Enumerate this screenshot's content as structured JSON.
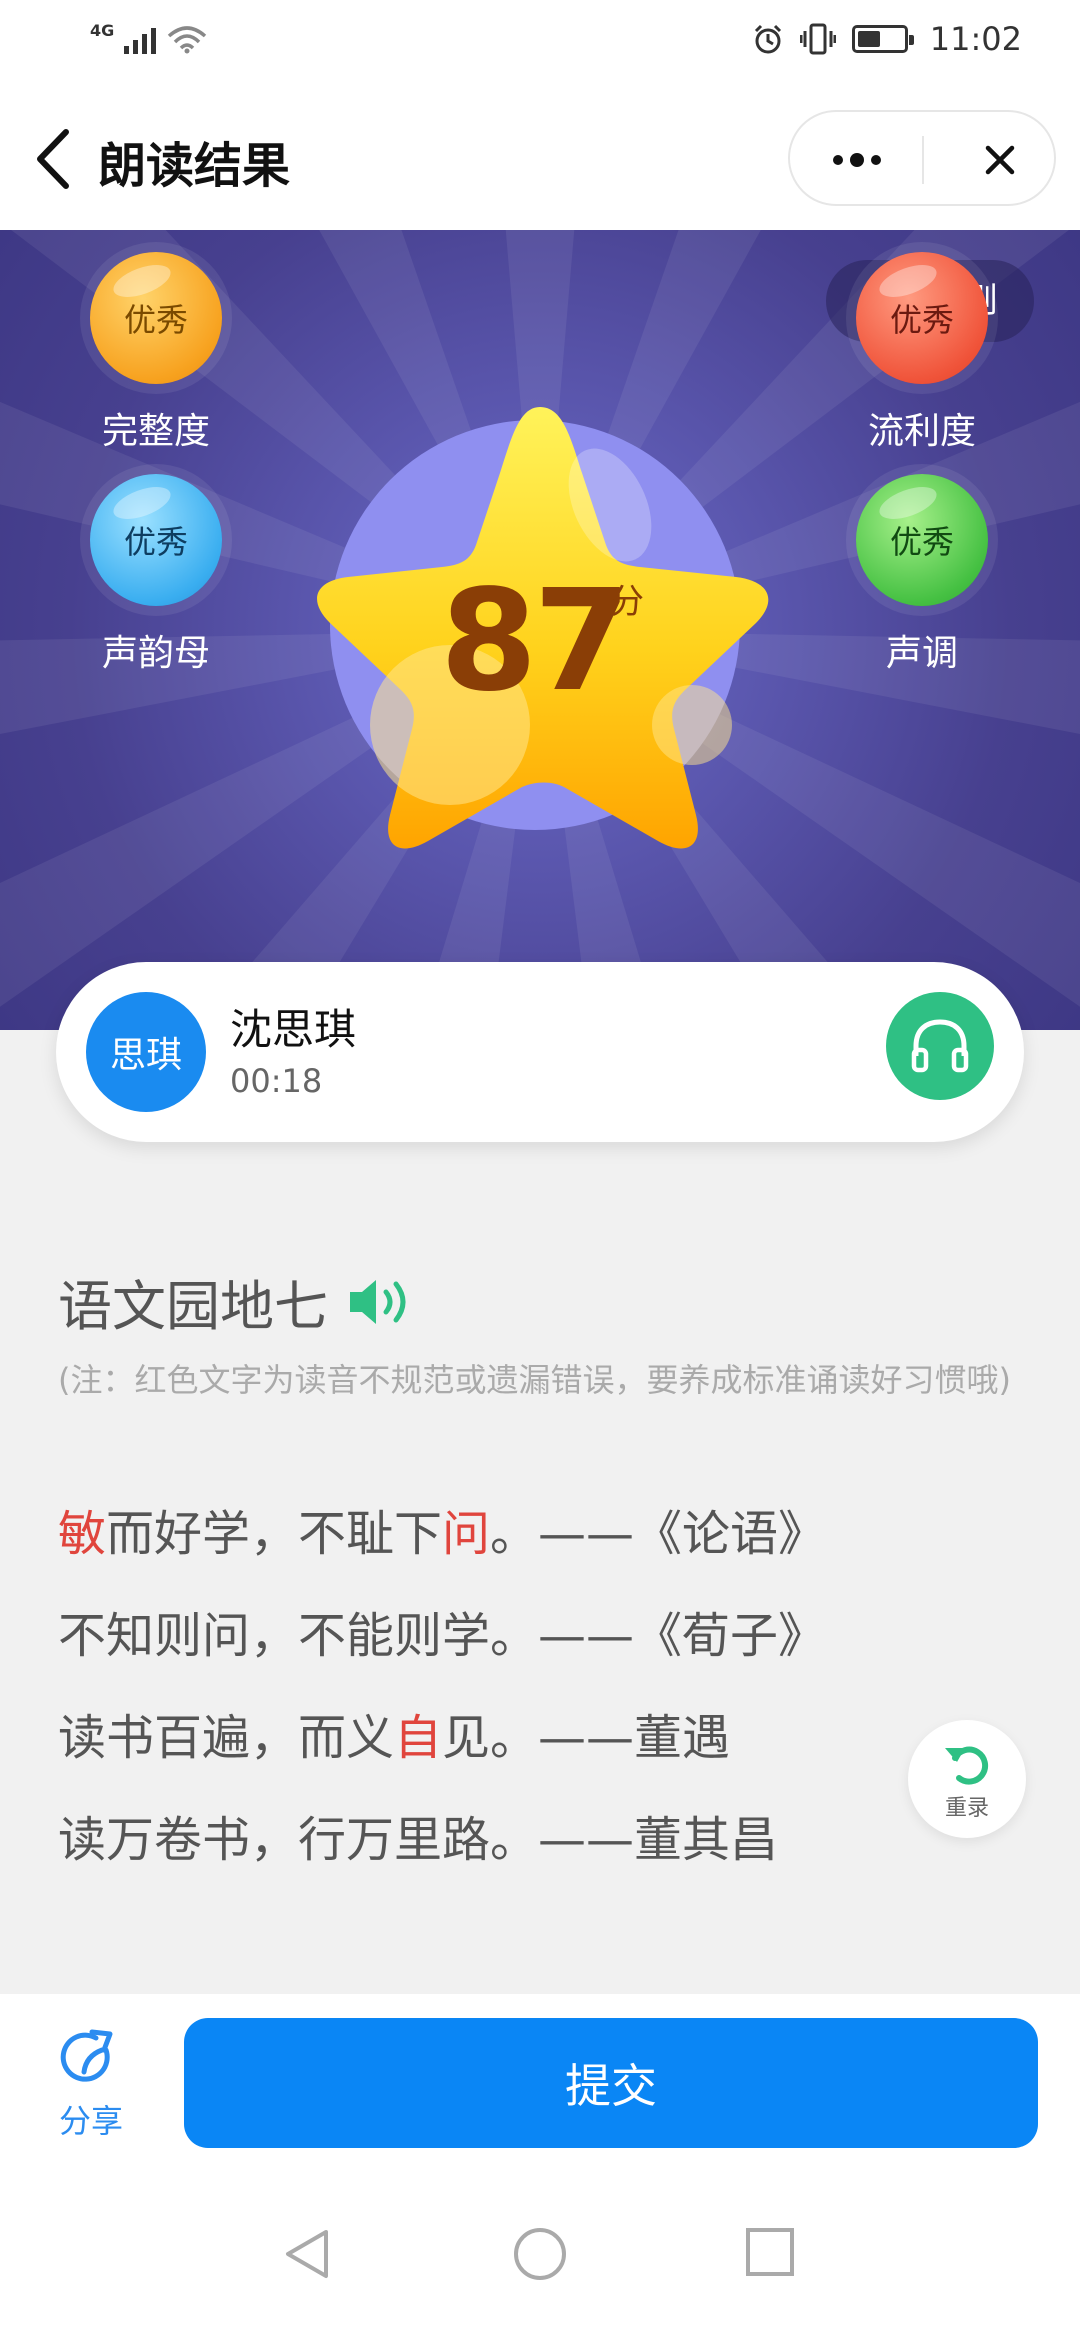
{
  "status_bar": {
    "network": "4G",
    "time": "11:02"
  },
  "nav": {
    "title": "朗读结果"
  },
  "hero": {
    "rules_label": "评分规则",
    "score": "87",
    "score_unit": "分",
    "metrics": [
      {
        "grade": "优秀",
        "label": "完整度"
      },
      {
        "grade": "优秀",
        "label": "流利度"
      },
      {
        "grade": "优秀",
        "label": "声韵母"
      },
      {
        "grade": "优秀",
        "label": "声调"
      }
    ]
  },
  "user": {
    "avatar_text": "思琪",
    "name": "沈思琪",
    "duration": "00:18"
  },
  "content": {
    "title": "语文园地七",
    "note": "(注：红色文字为读音不规范或遗漏错误，要养成标准诵读好习惯哦)",
    "lines": [
      {
        "segments": [
          {
            "t": "敏",
            "err": true
          },
          {
            "t": "而好学，不耻下",
            "err": false
          },
          {
            "t": "问",
            "err": true
          },
          {
            "t": "。——《论语》",
            "err": false
          }
        ]
      },
      {
        "segments": [
          {
            "t": "不知则问，不能则学。——《荀子》",
            "err": false
          }
        ]
      },
      {
        "segments": [
          {
            "t": "读书百遍，而义",
            "err": false
          },
          {
            "t": "自",
            "err": true
          },
          {
            "t": "见。——董遇",
            "err": false
          }
        ]
      },
      {
        "segments": [
          {
            "t": "读万卷书，行万里路。——董其昌",
            "err": false
          }
        ]
      }
    ],
    "rerecord_label": "重录"
  },
  "bottom": {
    "share_label": "分享",
    "submit_label": "提交"
  },
  "colors": {
    "accent": "#0a86f5",
    "error": "#e0453d",
    "listen": "#2fc084",
    "hero_bg": "#47408f"
  }
}
